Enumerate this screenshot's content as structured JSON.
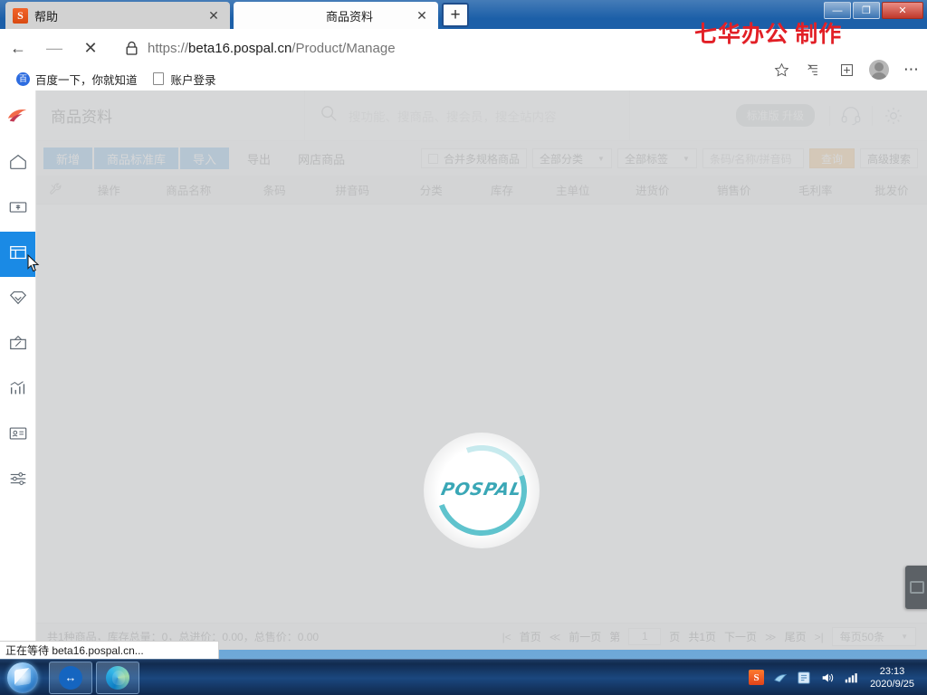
{
  "browser": {
    "tabs": [
      {
        "title": "帮助",
        "favicon": "sogou-icon",
        "active": false,
        "close": "✕"
      },
      {
        "title": "商品资料",
        "favicon": "none",
        "active": true,
        "close": "✕"
      }
    ],
    "new_tab_label": "+",
    "window_controls": {
      "minimize": "—",
      "maximize": "❐",
      "close": "✕"
    },
    "nav": {
      "back": "←",
      "forward": "—",
      "stop": "✕"
    },
    "url_scheme": "https://",
    "url_host": "beta16.pospal.cn",
    "url_path": "/Product/Manage",
    "lock_icon": "lock-icon",
    "bookmarks": [
      {
        "label": "百度一下，你就知道",
        "icon": "baidu-icon"
      },
      {
        "label": "账户登录",
        "icon": "page-icon"
      }
    ],
    "right_icons": [
      "star-icon",
      "collections-icon",
      "add-icon",
      "profile-icon",
      "more-icon"
    ],
    "menu_dots": "⋯",
    "status_tip": "正在等待 beta16.pospal.cn..."
  },
  "watermark": {
    "text": "七华办公  制作"
  },
  "rail": {
    "logo": "pospal-logo-icon",
    "items": [
      {
        "name": "home",
        "icon": "home-icon",
        "active": false
      },
      {
        "name": "cashier",
        "icon": "banknote-icon",
        "active": false
      },
      {
        "name": "product",
        "icon": "box-icon",
        "active": true
      },
      {
        "name": "member",
        "icon": "diamond-icon",
        "active": false
      },
      {
        "name": "promotion",
        "icon": "gift-icon",
        "active": false
      },
      {
        "name": "report",
        "icon": "chart-icon",
        "active": false
      },
      {
        "name": "staff",
        "icon": "id-card-icon",
        "active": false
      },
      {
        "name": "settings",
        "icon": "sliders-icon",
        "active": false
      }
    ]
  },
  "header": {
    "page_title": "商品资料",
    "search_icon": "search-icon",
    "search_placeholder": "搜功能、搜商品、搜会员，搜全站内容",
    "search_value": "",
    "plan_badge": "标准版 升级",
    "support_icon": "headset-icon",
    "settings_icon": "gear-icon"
  },
  "toolbar": {
    "primary_buttons": [
      {
        "label": "新增",
        "name": "add-product-button"
      },
      {
        "label": "商品标准库",
        "name": "standard-library-button"
      },
      {
        "label": "导入",
        "name": "import-button"
      }
    ],
    "link_buttons": [
      {
        "label": "导出",
        "name": "export-button"
      },
      {
        "label": "网店商品",
        "name": "online-shop-products-button"
      }
    ],
    "merge_checkbox": {
      "label": "合并多规格商品",
      "checked": false
    },
    "category_select": {
      "value": "全部分类",
      "caret": "▼"
    },
    "tag_select": {
      "value": "全部标签",
      "caret": "▼"
    },
    "keyword_input": {
      "value": "",
      "placeholder": "条码/名称/拼音码"
    },
    "query_button": "查询",
    "advanced_search_button": "高级搜索"
  },
  "table": {
    "tools_icon": "wrench-icon",
    "columns": [
      "操作",
      "商品名称",
      "条码",
      "拼音码",
      "分类",
      "库存",
      "主单位",
      "进货价",
      "销售价",
      "毛利率",
      "批发价"
    ],
    "rows": []
  },
  "loading": {
    "brand_text": "POSPAL",
    "spinner": "loading-spinner"
  },
  "float_widget": {
    "name": "screen-widget"
  },
  "status": {
    "summary": "共1种商品，库存总量：0，总进价：0.00，总售价：0.00"
  },
  "pager": {
    "first": "首页",
    "first_icon": "|<",
    "prev": "前一页",
    "prev_icon": "≪",
    "page_prefix": "第",
    "page_value": "1",
    "page_suffix": "页",
    "total_pages": "共1页",
    "next": "下一页",
    "next_icon": "≫",
    "last": "尾页",
    "last_icon": ">|",
    "per_page": "每页50条",
    "per_page_caret": "▼"
  },
  "taskbar": {
    "start": "start-orb",
    "apps": [
      {
        "name": "teamviewer",
        "glyph": "↔"
      },
      {
        "name": "edge",
        "glyph": ""
      }
    ],
    "tray": [
      "sogou-ime-icon",
      "network-flag-icon",
      "update-icon",
      "volume-icon",
      "signal-icon"
    ],
    "tray_sogou_glyph": "S",
    "time": "23:13",
    "date": "2020/9/25"
  }
}
